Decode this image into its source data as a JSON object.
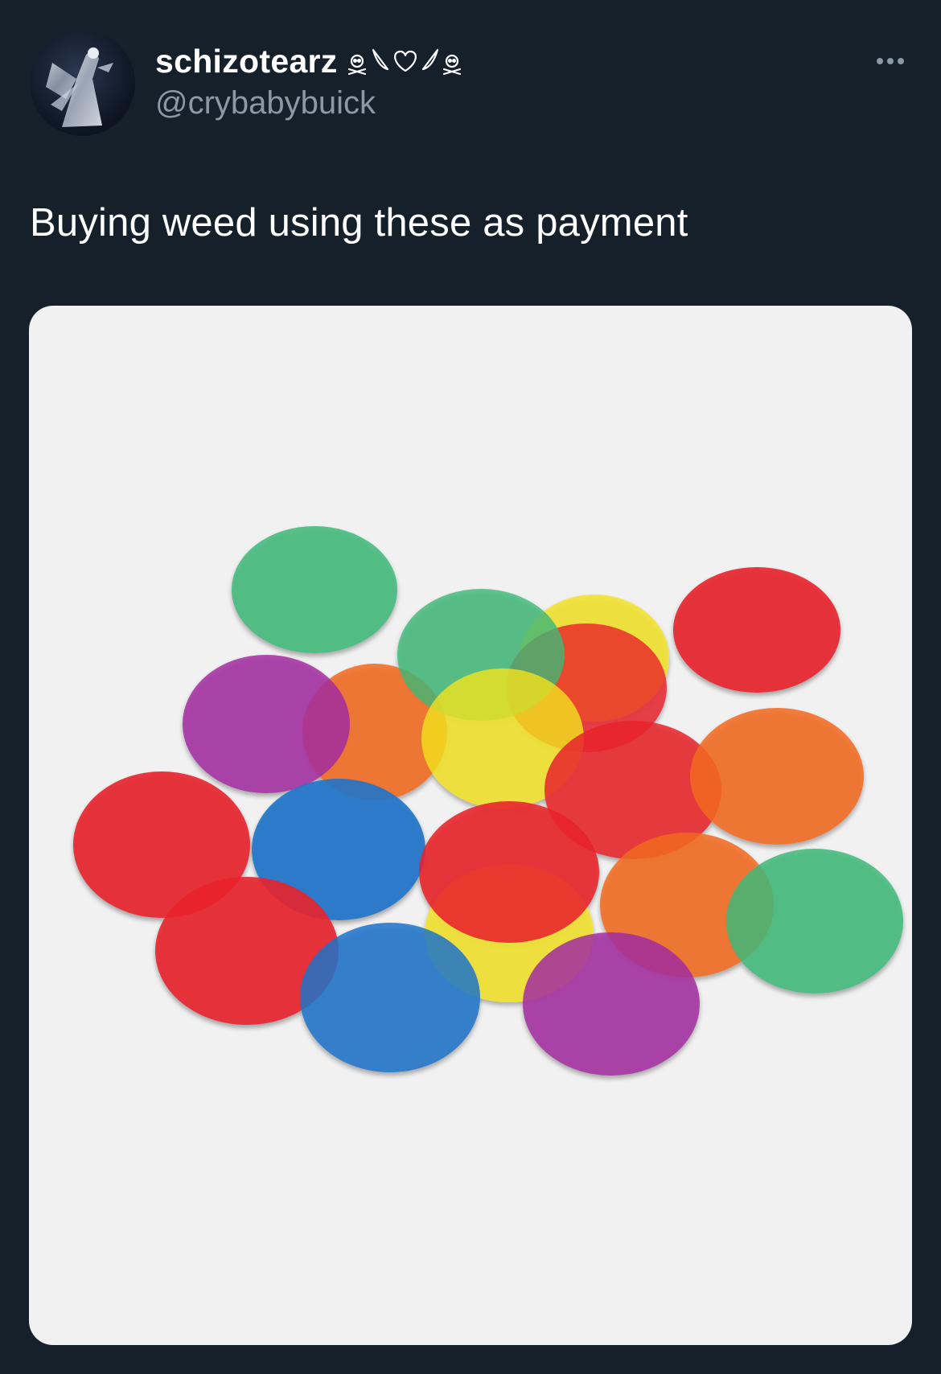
{
  "tweet": {
    "author": {
      "display_name": "schizotearz",
      "name_decoration_icons": [
        "skull-crossbones-icon",
        "left-wing-icon",
        "heart-outline-icon",
        "right-wing-icon",
        "skull-crossbones-icon"
      ],
      "handle": "@crybabybuick",
      "avatar_icon": "silver-angel-figure-avatar"
    },
    "more_icon": "ellipsis-icon",
    "text": "Buying weed using these as payment",
    "media": {
      "kind": "photo",
      "subject": "translucent-colored-counter-chips",
      "background_color": "#f1f1f1",
      "chip_colors": {
        "red": "#e8232b",
        "orange": "#f26a22",
        "yellow": "#f3e21e",
        "green": "#3fb878",
        "blue": "#1f74c9",
        "purple": "#a22ea0"
      }
    }
  },
  "colors": {
    "background": "#15202b",
    "text_primary": "#ffffff",
    "text_secondary": "#8b98a5"
  }
}
